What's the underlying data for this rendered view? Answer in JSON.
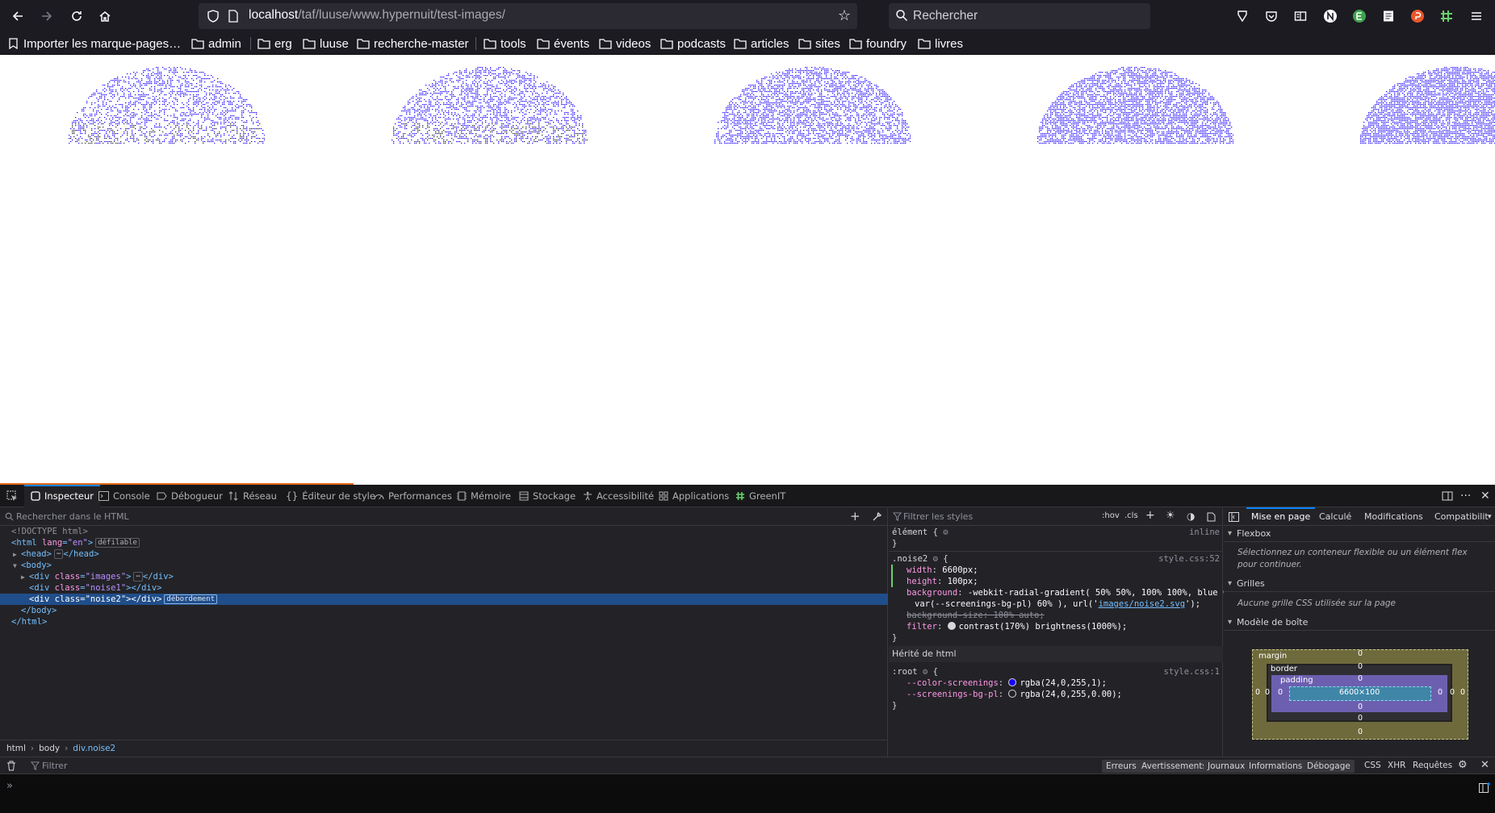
{
  "browser": {
    "url_host": "localhost",
    "url_path": "/taf/luuse/www.hypernuit/test-images/",
    "search_placeholder": "Rechercher",
    "bookmarks": [
      "Importer les marque-pages…",
      "admin",
      "erg",
      "luuse",
      "recherche-master",
      "tools",
      "évents",
      "videos",
      "podcasts",
      "articles",
      "sites",
      "foundry",
      "livres"
    ]
  },
  "devtools": {
    "tabs": [
      "Inspecteur",
      "Console",
      "Débogueur",
      "Réseau",
      "Éditeur de style",
      "Performances",
      "Mémoire",
      "Stockage",
      "Accessibilité",
      "Applications",
      "GreenIT"
    ],
    "html_search_placeholder": "Rechercher dans le HTML",
    "tree": {
      "doctype": "<!DOCTYPE html>",
      "html_open_tag": "html",
      "html_attr": "lang",
      "html_attr_val": "\"en\"",
      "badge_scroll": "défilable",
      "head": "head",
      "body": "body",
      "div": "div",
      "class_attr": "class",
      "images_class": "\"images\"",
      "noise1_class": "\"noise1\"",
      "noise2_class": "\"noise2\"",
      "badge_overflow": "débordement"
    },
    "breadcrumbs": [
      "html",
      "body",
      "div.noise2"
    ],
    "rules": {
      "filter_placeholder": "Filtrer les styles",
      "hov": ":hov",
      "cls": ".cls",
      "element_selector": "élément {",
      "element_source": "inline",
      "noise2_selector": ".noise2",
      "noise2_source": "style.css:52",
      "width": {
        "name": "width",
        "value": "6600px;"
      },
      "height": {
        "name": "height",
        "value": "100px;"
      },
      "background": {
        "name": "background",
        "value": "-webkit-radial-gradient( 50% 50%, 100% 100%, blue 0%,"
      },
      "background_cont": "var(--screenings-bg-pl) 60% ), url('",
      "background_url": "images/noise2.svg",
      "background_end": "');",
      "background_size": {
        "name": "background-size",
        "value": "100% auto;"
      },
      "filter": {
        "name": "filter",
        "value": "contrast(170%) brightness(1000%);"
      },
      "inherited_header": "Hérité de html",
      "root_selector": ":root",
      "root_source": "style.css:1",
      "var1": {
        "name": "--color-screenings",
        "value": "rgba(24,0,255,1);",
        "swatch": "#1800ff"
      },
      "var2": {
        "name": "--screenings-bg-pl",
        "value": "rgba(24,0,255,0.00);",
        "swatch": "transparent"
      }
    },
    "layout": {
      "tabs": [
        "Mise en page",
        "Calculé",
        "Modifications",
        "Compatibilit"
      ],
      "flexbox_header": "Flexbox",
      "flexbox_text": "Sélectionnez un conteneur flexible ou un élément flex pour continuer.",
      "grids_header": "Grilles",
      "grids_text": "Aucune grille CSS utilisée sur la page",
      "boxmodel_header": "Modèle de boîte",
      "box": {
        "margin": "margin",
        "border": "border",
        "padding": "padding",
        "content": "6600×100",
        "zero": "0"
      }
    },
    "console": {
      "filter_placeholder": "Filtrer",
      "levels": [
        "Erreurs",
        "Avertissements",
        "Journaux",
        "Informations",
        "Débogage"
      ],
      "extra": [
        "CSS",
        "XHR",
        "Requêtes"
      ]
    }
  }
}
